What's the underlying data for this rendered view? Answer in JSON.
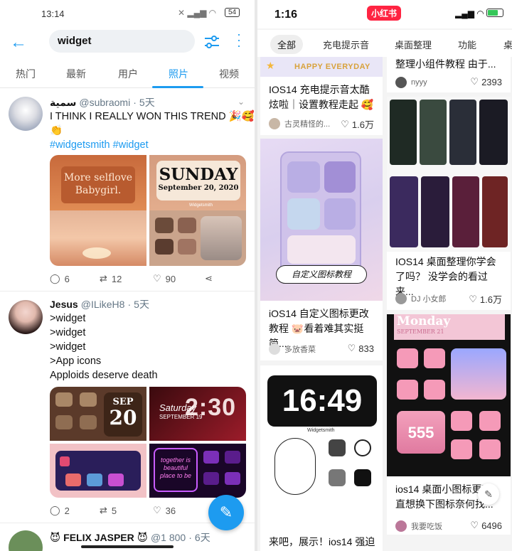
{
  "left": {
    "status": {
      "time": "13:14",
      "battery": "54"
    },
    "search": {
      "query": "widget"
    },
    "tabs": [
      "热门",
      "最新",
      "用户",
      "照片",
      "视频"
    ],
    "tweets": [
      {
        "name": "سمية",
        "handle": "@subraomi",
        "time": "5天",
        "lines": [
          "I THINK I REALLY WON THIS TREND 🎉🥰",
          "👏"
        ],
        "hashtags": [
          "#widgetsmith",
          "#widget"
        ],
        "media": {
          "a": "More selflove Babygirl.",
          "b_title": "SUNDAY",
          "b_sub": "September 20, 2020",
          "label": "Widgetsmith"
        },
        "replies": "6",
        "retweets": "12",
        "likes": "90"
      },
      {
        "name": "Jesus",
        "handle": "@ILikeH8",
        "time": "5天",
        "lines": [
          ">widget",
          ">widget",
          ">widget",
          ">App icons",
          "Apploids deserve death"
        ],
        "media": {
          "month": "SEP",
          "day": "20",
          "clock": "2:30",
          "clock_day": "Saturday",
          "clock_date": "SEPTEMBER 19",
          "neon": "together is beautiful place to be"
        },
        "replies": "2",
        "retweets": "5",
        "likes": "36"
      },
      {
        "name": "FELIX JASPER",
        "handle": "@1 800",
        "time": "6天"
      }
    ]
  },
  "right": {
    "status": {
      "time": "1:16",
      "brand": "小红书"
    },
    "tabs": [
      "全部",
      "充电提示音",
      "桌面整理",
      "功能",
      "桌"
    ],
    "cards": [
      {
        "banner": "HAPPY EVERYDAY",
        "text": "IOS14 充电提示音太酷炫啦｜设置教程走起 🥰",
        "user": "古灵精怪的...",
        "likes": "1.6万"
      },
      {
        "text": "整理小组件教程 由于...",
        "user": "nyyy",
        "likes": "2393"
      },
      {
        "overlay": "自定义图标教程",
        "text": "iOS14 自定义图标更改教程 🐷看着难其实挺简...",
        "user": "多放香菜",
        "likes": "833"
      },
      {
        "text": "IOS14 桌面整理你学会了吗？ 没学会的看过来...",
        "user": "DJ 小女郎",
        "likes": "1.6万"
      },
      {
        "clock": "16:49",
        "label": "Widgetsmith",
        "text": "来吧，展示！ios14 强迫"
      },
      {
        "day": "Monday",
        "date": "SEPTEMBER 21",
        "num": "555",
        "text": "ios14 桌面小图标更改 直想换下图标奈何找...",
        "user": "我要吃饭",
        "likes": "6496"
      }
    ]
  }
}
